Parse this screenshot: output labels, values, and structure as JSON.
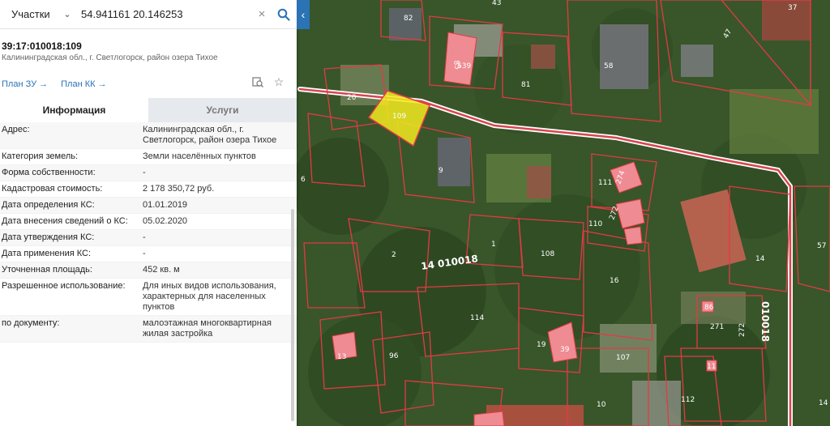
{
  "search": {
    "type_label": "Участки",
    "query": "54.941161 20.146253"
  },
  "object": {
    "cadastral_number": "39:17:010018:109",
    "address_short": "Калининградская обл., г. Светлогорск, район озера Тихое"
  },
  "links": {
    "plan_zu": "План ЗУ →",
    "plan_kk": "План КК →"
  },
  "tabs": {
    "info": "Информация",
    "services": "Услуги"
  },
  "details": [
    {
      "label": "Адрес:",
      "value": "Калининградская обл., г. Светлогорск, район озера Тихое"
    },
    {
      "label": "Категория земель:",
      "value": "Земли населённых пунктов"
    },
    {
      "label": "Форма собственности:",
      "value": "-"
    },
    {
      "label": "Кадастровая стоимость:",
      "value": "2 178 350,72 руб."
    },
    {
      "label": "Дата определения КС:",
      "value": "01.01.2019"
    },
    {
      "label": "Дата внесения сведений о КС:",
      "value": "05.02.2020"
    },
    {
      "label": "Дата утверждения КС:",
      "value": "-"
    },
    {
      "label": "Дата применения КС:",
      "value": "-"
    },
    {
      "label": "Уточненная площадь:",
      "value": "452 кв. м"
    },
    {
      "label": "Разрешенное использование:",
      "value": "Для иных видов использования, характерных для населенных пунктов"
    },
    {
      "label": "по документу:",
      "value": "малоэтажная многоквартирная жилая застройка"
    }
  ],
  "map": {
    "selected_parcel_label": "109",
    "block_labels": [
      "010018",
      "010018"
    ],
    "parcel_labels": [
      "82",
      "43",
      "37",
      "47",
      "539",
      "58",
      "81",
      "85",
      "20",
      "109",
      "9",
      "6",
      "111",
      "274",
      "272",
      "110",
      "1",
      "2",
      "108",
      "14",
      "16",
      "57",
      "114",
      "86",
      "271",
      "272",
      "19",
      "39",
      "96",
      "13",
      "107",
      "11",
      "112",
      "10",
      "14"
    ],
    "colors": {
      "parcel_outline": "#e23a45",
      "selected_fill": "#f2ea1e",
      "building_fill": "#ef8b92",
      "street_line": "#ffffff"
    }
  },
  "icons": {
    "search": "search-icon",
    "clear": "close-icon",
    "chevron": "chevron-down-icon",
    "collapse": "chevron-left-icon",
    "print": "print-search-icon",
    "favorite": "star-icon"
  }
}
